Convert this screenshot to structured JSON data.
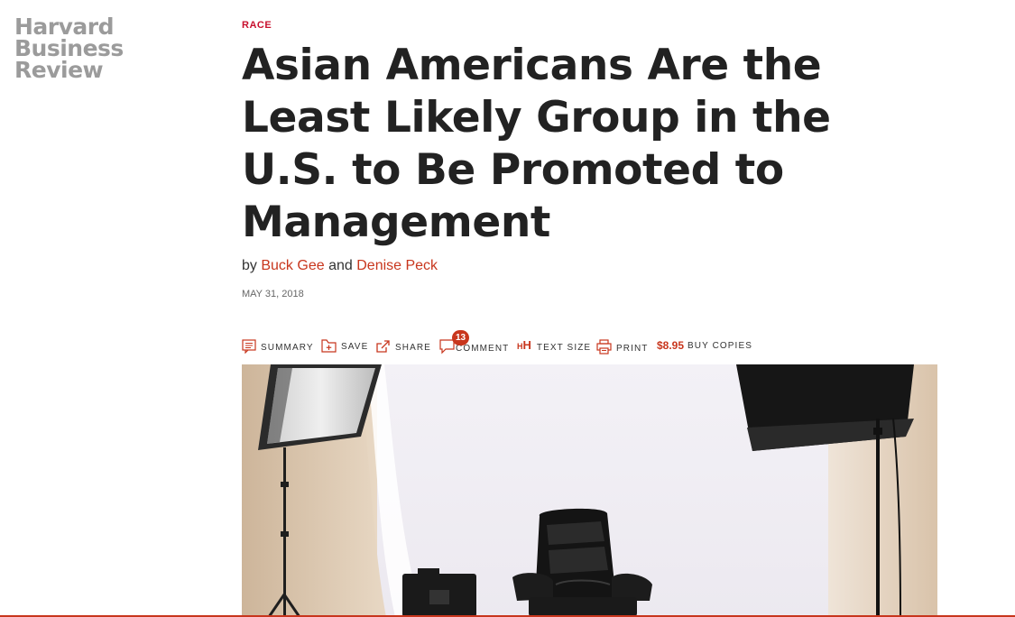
{
  "brand": {
    "logo_line1": "Harvard",
    "logo_line2": "Business",
    "logo_line3": "Review",
    "accent_color": "#c8361d",
    "logo_color": "#9b9b9b"
  },
  "article": {
    "topic": "RACE",
    "title": "Asian Americans Are the Least Likely Group in the U.S. to Be Promoted to Management",
    "byline_prefix": "by",
    "author1": "Buck Gee",
    "byline_and": "and",
    "author2": "Denise Peck",
    "date": "MAY 31, 2018"
  },
  "toolbar": {
    "summary_label": "SUMMARY",
    "save_label": "SAVE",
    "share_label": "SHARE",
    "comment_count": "13",
    "comment_label": "COMMENT",
    "text_size_label": "TEXT SIZE",
    "print_label": "PRINT",
    "price": "$8.95",
    "buy_label": "BUY COPIES"
  },
  "hero_image": {
    "icon": "photo-studio-empty-chair"
  }
}
